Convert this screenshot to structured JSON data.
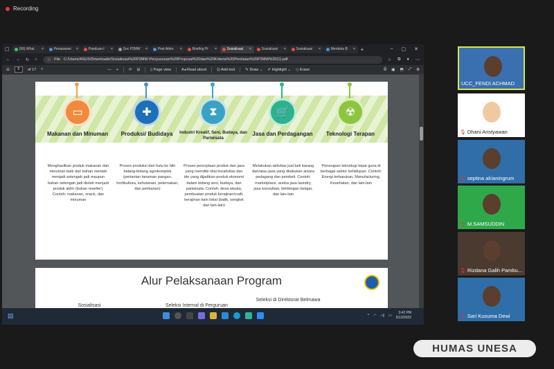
{
  "recording": {
    "label": "Recording"
  },
  "browser": {
    "tabs": [
      {
        "label": "(99) What",
        "color": "#25d366"
      },
      {
        "label": "Penawaran",
        "color": "#4a90e2"
      },
      {
        "label": "Panduan-I",
        "color": "#e84b3c"
      },
      {
        "label": "Soc P2MW",
        "color": "#9e9e9e"
      },
      {
        "label": "Post Atten",
        "color": "#4a90e2"
      },
      {
        "label": "Briefing Pr",
        "color": "#e84b3c"
      },
      {
        "label": "Sosialisasi",
        "color": "#e84b3c"
      },
      {
        "label": "Sosialisasi",
        "color": "#e84b3c"
      },
      {
        "label": "Sosialisasi",
        "color": "#e84b3c"
      },
      {
        "label": "Merdeka B",
        "color": "#4a90e2"
      }
    ],
    "url_prefix": "File",
    "url": "C:/Users/ASUS/Downloads/Sosialisasi%20P2MW-Penyusunan%20Proposal%20dan%20Kriteria%20Penilaian%20P2MW%20(1).pdf",
    "pdf_toolbar": {
      "page": "5",
      "page_total": "of 17",
      "page_view": "Page view",
      "read_aloud": "Read aloud",
      "add_text": "Add text",
      "draw": "Draw",
      "highlight": "Highlight",
      "erase": "Erase"
    }
  },
  "slide": {
    "columns": [
      {
        "title": "Makanan dan Minuman",
        "color": "#f08a3c",
        "pin": "#f0a050",
        "icon": "▭",
        "desc": "Menghasilkan produk makanan dan minuman baik dari bahan mentah menjadi setengah jadi maupun bahan setengah jadi diolah menjadi produk akhir (bukan reseller). Contoh: makanan, snack, dan minuman"
      },
      {
        "title": "Produksi/ Budidaya",
        "color": "#1d6fb8",
        "pin": "#4a90c8",
        "icon": "✚",
        "desc": "Proses produksi dari hulu ke hilir bidang-bidang agrokomplek (pertanian tanaman pangan, hortikultura, kehutanan, peternakan, dan perikanan)"
      },
      {
        "title": "Industri Kreatif, Seni, Budaya, dan Pariwisata",
        "color": "#3aa3c4",
        "pin": "#3aa3c4",
        "icon": "⧗",
        "desc": "Proses penciptaan produk dan jasa yang memiliki nilai kreativitas dan ide yang dijadikan produk ekonomi dalam bidang seni, budaya, dan pariwisata. Contoh: desa wisata, pembuatan produk kerajinan/craft, kerajinan kain lokal (batik, songket dan lain-lain)"
      },
      {
        "title": "Jasa dan Perdagangan",
        "color": "#2bb38c",
        "pin": "#2bb38c",
        "icon": "🛒",
        "desc": "Melakukan aktivitas jual beli barang dan/atau jasa yang dilakukan antara pedagang dan pembeli. Contoh: marketplace, aneka jasa laundry, jasa konsultasi, bimbingan belajar, dan lain-lain"
      },
      {
        "title": "Teknologi Terapan",
        "color": "#8cc63f",
        "pin": "#8cc63f",
        "icon": "☢",
        "desc": "Penerapan teknologi tepat guna di berbagai sektor kehidupan. Contoh: Energi terbarukan, Manufacturing, Kesehatan, dan lain-lain"
      }
    ],
    "page2_title": "Alur Pelaksanaan Program",
    "steps": [
      "Sosialisasi Program",
      "Seleksi Internal di Perguruan Tinggi",
      "Seleksi di Direktorat Belmawa"
    ]
  },
  "taskbar": {
    "time": "3:42 PM",
    "date": "5/12/2022"
  },
  "participants": [
    {
      "name": "UCC_FENDI ACHMAD",
      "muted": false,
      "bg": "#3a6fb0"
    },
    {
      "name": "Dhani Aristyawan",
      "muted": true,
      "bg": "#ffffff"
    },
    {
      "name": "septina alrianingrum",
      "muted": true,
      "bg": "#2f6ea8"
    },
    {
      "name": "M.SAMSUDDIN",
      "muted": true,
      "bg": "#2fa84a"
    },
    {
      "name": "Rizdana Galih Pambu...",
      "muted": true,
      "bg": "#4a3a30"
    },
    {
      "name": "Sari Kusuma Dewi",
      "muted": true,
      "bg": "#2f6ea8"
    }
  ],
  "watermark": "HUMAS UNESA"
}
